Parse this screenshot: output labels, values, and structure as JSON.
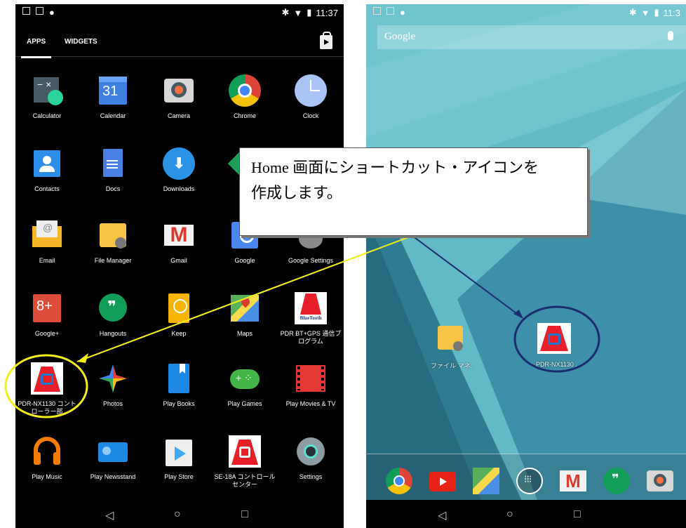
{
  "left_phone": {
    "status": {
      "time": "11:37"
    },
    "tabs": [
      {
        "label": "APPS"
      },
      {
        "label": "WIDGETS"
      }
    ],
    "apps": [
      {
        "label": "Calculator"
      },
      {
        "label": "Calendar"
      },
      {
        "label": "Camera"
      },
      {
        "label": "Chrome"
      },
      {
        "label": "Clock"
      },
      {
        "label": "Contacts"
      },
      {
        "label": "Docs"
      },
      {
        "label": "Downloads"
      },
      {
        "label": ""
      },
      {
        "label": ""
      },
      {
        "label": "Email"
      },
      {
        "label": "File Manager"
      },
      {
        "label": "Gmail"
      },
      {
        "label": "Google"
      },
      {
        "label": "Google Settings"
      },
      {
        "label": "Google+"
      },
      {
        "label": "Hangouts"
      },
      {
        "label": "Keep"
      },
      {
        "label": "Maps"
      },
      {
        "label": "PDR BT+GPS 通信プログラム"
      },
      {
        "label": "PDR-NX1130 コントローラー部"
      },
      {
        "label": "Photos"
      },
      {
        "label": "Play Books"
      },
      {
        "label": "Play Games"
      },
      {
        "label": "Play Movies & TV"
      },
      {
        "label": "Play Music"
      },
      {
        "label": "Play Newsstand"
      },
      {
        "label": "Play Store"
      },
      {
        "label": "SE-18A コントロールセンター"
      },
      {
        "label": "Settings"
      }
    ],
    "calendar_day": "31",
    "bluetooth_badge": "BlueTooth"
  },
  "right_phone": {
    "status": {
      "time": "11:3"
    },
    "search_text": "Google",
    "home_icons": [
      {
        "label": "ファイル マネ."
      },
      {
        "label": "PDR-NX1130 ."
      }
    ]
  },
  "callout": {
    "line1": "Home 画面にショートカット・アイコンを",
    "line2": "作成します。"
  },
  "colors": {
    "highlight": "#f4ef1a",
    "arrow": "#1c2a6e",
    "brand_red": "#e8202a"
  }
}
